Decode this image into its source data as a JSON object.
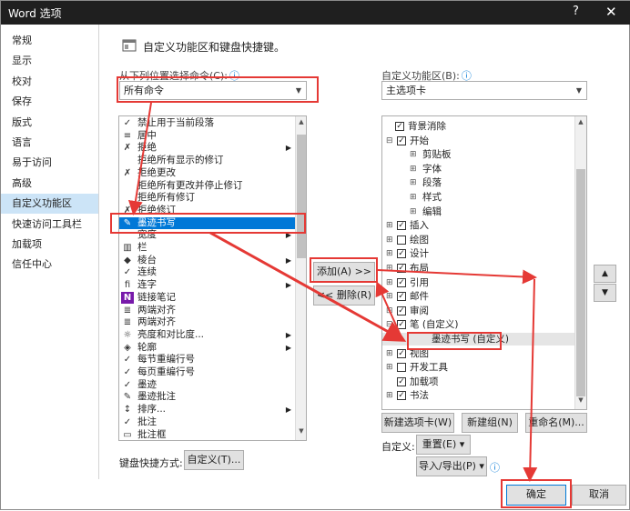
{
  "window": {
    "title": "Word 选项",
    "help_glyph": "?",
    "close_glyph": "✕"
  },
  "sidebar": {
    "items": [
      {
        "label": "常规"
      },
      {
        "label": "显示"
      },
      {
        "label": "校对"
      },
      {
        "label": "保存"
      },
      {
        "label": "版式"
      },
      {
        "label": "语言"
      },
      {
        "label": "易于访问"
      },
      {
        "label": "高级"
      },
      {
        "label": "自定义功能区",
        "selected": true
      },
      {
        "label": "快速访问工具栏"
      },
      {
        "label": "加载项"
      },
      {
        "label": "信任中心"
      }
    ]
  },
  "header": {
    "title": "自定义功能区和键盘快捷键。"
  },
  "left": {
    "choose_label": "从下列位置选择命令(C):",
    "info_glyph": "ⓘ",
    "dropdown_value": "所有命令",
    "commands": [
      {
        "icon": "✓",
        "label": "禁止用于当前段落"
      },
      {
        "icon": "≡",
        "label": "居中"
      },
      {
        "icon": "✗",
        "label": "拒绝"
      },
      {
        "icon": "",
        "label": "拒绝所有显示的修订"
      },
      {
        "icon": "✗",
        "label": "拒绝更改"
      },
      {
        "icon": "",
        "label": "拒绝所有更改并停止修订"
      },
      {
        "icon": "",
        "label": "拒绝所有修订"
      },
      {
        "icon": "✗",
        "label": "拒绝修订"
      },
      {
        "icon": "✎",
        "label": "墨迹书写"
      },
      {
        "icon": "",
        "label": "宽度"
      },
      {
        "icon": "▥",
        "label": "栏"
      },
      {
        "icon": "◆",
        "label": "棱台"
      },
      {
        "icon": "✓",
        "label": "连续"
      },
      {
        "icon": "ﬁ",
        "label": "连字"
      },
      {
        "icon": "N",
        "label": "链接笔记"
      },
      {
        "icon": "≣",
        "label": "两端对齐"
      },
      {
        "icon": "≣",
        "label": "两端对齐"
      },
      {
        "icon": "☼",
        "label": "亮度和对比度..."
      },
      {
        "icon": "◈",
        "label": "轮廓"
      },
      {
        "icon": "✓",
        "label": "每节重编行号"
      },
      {
        "icon": "✓",
        "label": "每页重编行号"
      },
      {
        "icon": "✓",
        "label": "墨迹"
      },
      {
        "icon": "✎",
        "label": "墨迹批注"
      },
      {
        "icon": "↕",
        "label": "排序..."
      },
      {
        "icon": "✓",
        "label": "批注"
      },
      {
        "icon": "▭",
        "label": "批注框"
      }
    ],
    "keyboard_label": "键盘快捷方式:",
    "customize_btn": "自定义(T)..."
  },
  "middle": {
    "add_btn": "添加(A) >>",
    "remove_btn": "<< 删除(R)"
  },
  "right": {
    "customize_label": "自定义功能区(B):",
    "info_glyph": "ⓘ",
    "dropdown_value": "主选项卡",
    "tree": [
      {
        "lvl": 1,
        "exp": "",
        "cb": true,
        "label": "背景消除"
      },
      {
        "lvl": 0,
        "exp": "⊟",
        "cb": true,
        "label": "开始"
      },
      {
        "lvl": 1,
        "exp": "⊞",
        "cb": null,
        "label": "剪贴板"
      },
      {
        "lvl": 1,
        "exp": "⊞",
        "cb": null,
        "label": "字体"
      },
      {
        "lvl": 1,
        "exp": "⊞",
        "cb": null,
        "label": "段落"
      },
      {
        "lvl": 1,
        "exp": "⊞",
        "cb": null,
        "label": "样式"
      },
      {
        "lvl": 1,
        "exp": "⊞",
        "cb": null,
        "label": "编辑"
      },
      {
        "lvl": 0,
        "exp": "⊞",
        "cb": true,
        "label": "插入"
      },
      {
        "lvl": 0,
        "exp": "⊞",
        "cb": false,
        "label": "绘图"
      },
      {
        "lvl": 0,
        "exp": "⊞",
        "cb": true,
        "label": "设计"
      },
      {
        "lvl": 0,
        "exp": "⊞",
        "cb": true,
        "label": "布局"
      },
      {
        "lvl": 0,
        "exp": "⊞",
        "cb": true,
        "label": "引用"
      },
      {
        "lvl": 0,
        "exp": "⊞",
        "cb": true,
        "label": "邮件"
      },
      {
        "lvl": 0,
        "exp": "⊞",
        "cb": true,
        "label": "审阅"
      },
      {
        "lvl": 0,
        "exp": "⊟",
        "cb": true,
        "label": "笔 (自定义)"
      },
      {
        "lvl": 2,
        "exp": "",
        "cb": null,
        "label": "墨迹书写 (自定义)"
      },
      {
        "lvl": 0,
        "exp": "⊞",
        "cb": true,
        "label": "视图"
      },
      {
        "lvl": 0,
        "exp": "⊞",
        "cb": false,
        "label": "开发工具"
      },
      {
        "lvl": 0,
        "exp": "",
        "cb": true,
        "label": "加载项"
      },
      {
        "lvl": 0,
        "exp": "⊞",
        "cb": true,
        "label": "书法"
      }
    ],
    "new_tab_btn": "新建选项卡(W)",
    "new_group_btn": "新建组(N)",
    "rename_btn": "重命名(M)...",
    "customize_label2": "自定义:",
    "reset_btn": "重置(E) ▾",
    "import_export_btn": "导入/导出(P) ▾",
    "up_glyph": "▲",
    "down_glyph": "▼"
  },
  "footer": {
    "ok_btn": "确定",
    "cancel_btn": "取消"
  },
  "colors": {
    "accent": "#0078d7",
    "annotation": "#e53935",
    "title_bar": "#1f1f1f"
  }
}
